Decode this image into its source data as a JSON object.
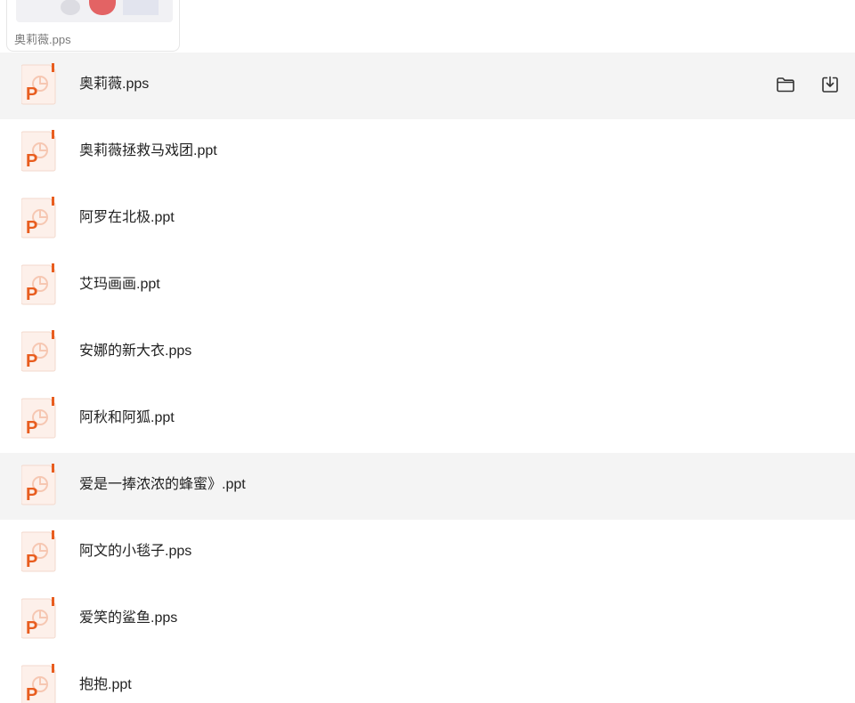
{
  "drag_preview": {
    "file_name": "奥莉薇.pps"
  },
  "files": [
    {
      "name": "奥莉薇.pps",
      "type": "ppt-icon",
      "state": "hover"
    },
    {
      "name": "奥莉薇拯救马戏团.ppt",
      "type": "ppt-icon",
      "state": "normal"
    },
    {
      "name": "阿罗在北极.ppt",
      "type": "ppt-icon",
      "state": "normal"
    },
    {
      "name": "艾玛画画.ppt",
      "type": "ppt-icon",
      "state": "normal"
    },
    {
      "name": "安娜的新大衣.pps",
      "type": "ppt-icon",
      "state": "normal"
    },
    {
      "name": "阿秋和阿狐.ppt",
      "type": "ppt-icon",
      "state": "normal"
    },
    {
      "name": "爱是一捧浓浓的蜂蜜》.ppt",
      "type": "ppt-icon",
      "state": "selected"
    },
    {
      "name": "阿文的小毯子.pps",
      "type": "ppt-icon",
      "state": "normal"
    },
    {
      "name": "爱笑的鲨鱼.pps",
      "type": "ppt-icon",
      "state": "normal"
    },
    {
      "name": "抱抱.ppt",
      "type": "ppt-icon",
      "state": "normal"
    }
  ],
  "row_actions": [
    {
      "icon": "folder-icon"
    },
    {
      "icon": "download-icon"
    }
  ],
  "colors": {
    "ppt_orange": "#e85d1f",
    "ppt_bg": "#fdf0ea",
    "row_highlight": "#f4f4f4",
    "text": "#222222"
  }
}
